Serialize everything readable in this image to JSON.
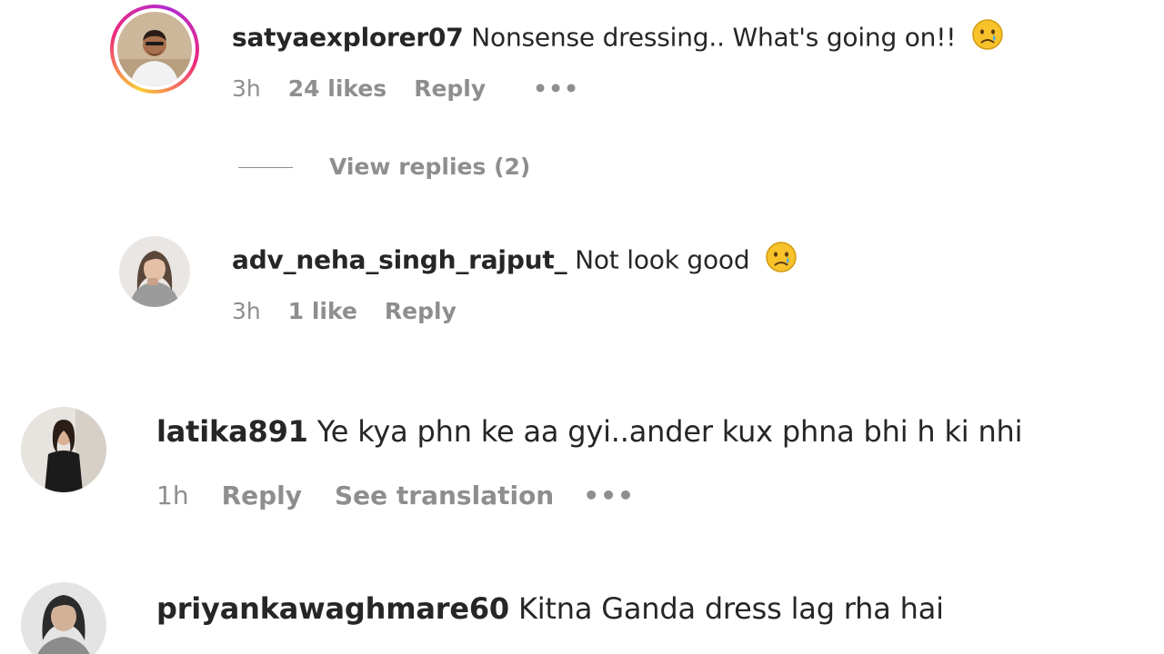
{
  "comments": [
    {
      "username": "satyaexplorer07",
      "text": "Nonsense dressing.. What's going on!!",
      "emoji": "crying-face",
      "time": "3h",
      "likes": "24 likes",
      "reply_label": "Reply",
      "more_label": "•••",
      "view_replies": "View replies (2)"
    },
    {
      "username": "adv_neha_singh_rajput_",
      "text": "Not look good",
      "emoji": "crying-face",
      "time": "3h",
      "likes": "1 like",
      "reply_label": "Reply"
    },
    {
      "username": "latika891",
      "text": "Ye kya phn ke aa gyi..ander kux phna bhi h ki nhi",
      "time": "1h",
      "reply_label": "Reply",
      "translate_label": "See translation",
      "more_label": "•••"
    },
    {
      "username": "priyankawaghmare60",
      "text": "Kitna Ganda dress lag rha hai"
    }
  ],
  "colors": {
    "text": "#262626",
    "secondary": "#8e8e8e",
    "story_ring": [
      "#f9ce34",
      "#ee2a7b",
      "#b32bd1"
    ]
  }
}
